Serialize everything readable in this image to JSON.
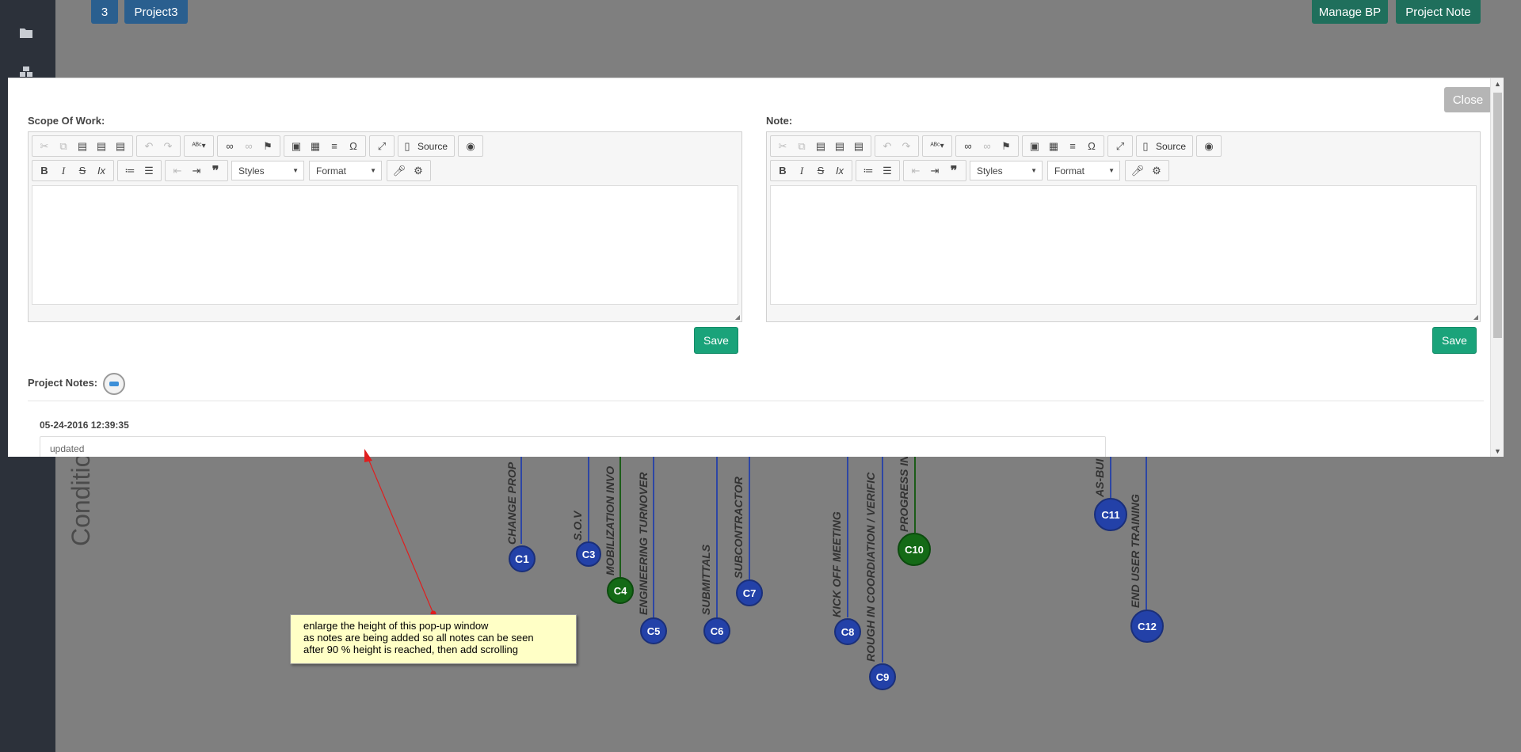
{
  "header": {
    "tab_number": "3",
    "project_name": "Project3",
    "manage_bp_label": "Manage BP",
    "project_note_label": "Project Note"
  },
  "sidebar": {
    "icons": [
      "folder-icon",
      "cubes-icon"
    ]
  },
  "background": {
    "conditions_label": "Conditio",
    "milestones": [
      {
        "id": "C1",
        "label": "CHANGE PROP",
        "status": "blue"
      },
      {
        "id": "C3",
        "label": "S.O.V",
        "status": "blue"
      },
      {
        "id": "C4",
        "label": "MOBILIZATION INVO",
        "status": "green"
      },
      {
        "id": "C5",
        "label": "ENGINEERING TURNOVER",
        "status": "blue"
      },
      {
        "id": "C6",
        "label": "SUBMITTALS",
        "status": "blue"
      },
      {
        "id": "C7",
        "label": "SUBCONTRACTOR",
        "status": "blue"
      },
      {
        "id": "C8",
        "label": "KICK OFF MEETING",
        "status": "blue"
      },
      {
        "id": "C9",
        "label": "ROUGH IN COORDIATION / VERIFIC",
        "status": "blue"
      },
      {
        "id": "C10",
        "label": "PROGRESS IN",
        "status": "green"
      },
      {
        "id": "C11",
        "label": "AS-BUI",
        "status": "blue"
      },
      {
        "id": "C12",
        "label": "END USER TRAINING",
        "status": "blue"
      }
    ]
  },
  "modal": {
    "close_label": "Close",
    "scope_label": "Scope Of Work:",
    "note_label": "Note:",
    "save_label": "Save",
    "editor": {
      "source_label": "Source",
      "styles_label": "Styles",
      "format_label": "Format"
    },
    "project_notes_label": "Project Notes:",
    "notes": [
      {
        "date": "05-24-2016 12:39:35",
        "text": "updated"
      }
    ]
  },
  "annotation": {
    "lines": [
      "enlarge the height of this pop-up window",
      "as notes are being added so all notes can be seen",
      "after 90 % height is reached, then add scrolling"
    ]
  },
  "colors": {
    "save_green": "#1aa37a",
    "node_blue": "#2341a8",
    "node_green": "#146a16",
    "arrow_red": "#e01e1e"
  }
}
